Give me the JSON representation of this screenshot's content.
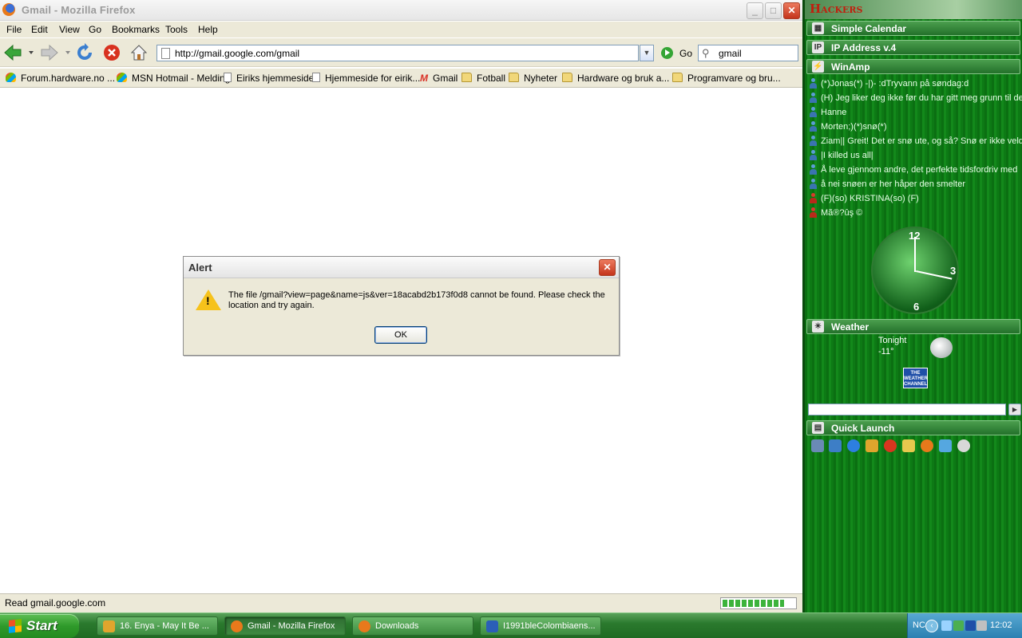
{
  "window": {
    "title": "Gmail - Mozilla Firefox"
  },
  "menu": [
    "File",
    "Edit",
    "View",
    "Go",
    "Bookmarks",
    "Tools",
    "Help"
  ],
  "navbar": {
    "url": "http://gmail.google.com/gmail",
    "go_label": "Go",
    "search_value": "gmail"
  },
  "bookmarks": [
    {
      "label": "Forum.hardware.no ...",
      "icon": "ms"
    },
    {
      "label": "MSN Hotmail - Melding",
      "icon": "ms"
    },
    {
      "label": "Eiriks hjemmeside",
      "icon": "page"
    },
    {
      "label": "Hjemmeside for eirik...",
      "icon": "page"
    },
    {
      "label": "Gmail",
      "icon": "gmail"
    },
    {
      "label": "Fotball",
      "icon": "folder"
    },
    {
      "label": "Nyheter",
      "icon": "folder"
    },
    {
      "label": "Hardware og bruk a...",
      "icon": "folder"
    },
    {
      "label": "Programvare og bru...",
      "icon": "folder"
    }
  ],
  "status": {
    "text": "Read gmail.google.com",
    "progress": 0.85
  },
  "alert": {
    "title": "Alert",
    "message": "The file /gmail?view=page&name=js&ver=18acabd2b173f0d8 cannot be found. Please check the location and try again.",
    "ok_label": "OK"
  },
  "sidebar": {
    "brand": "Hackers",
    "gadgets": {
      "calendar": "Simple Calendar",
      "ip": "IP Address v.4",
      "winamp": "WinAmp",
      "weather": "Weather",
      "quick_launch": "Quick Launch"
    },
    "winamp_items": [
      {
        "text": "(*)Jonas(*) -|)- :dTryvann på søndag:d",
        "status": "online"
      },
      {
        "text": "(H) Jeg liker deg ikke før du har gitt meg grunn til det",
        "status": "online"
      },
      {
        "text": "Hanne",
        "status": "online"
      },
      {
        "text": "Morten;)(*)snø(*)",
        "status": "online"
      },
      {
        "text": "Ziam|| Greit! Det er snø ute, og så? Snø er ikke veldig",
        "status": "online"
      },
      {
        "text": "|I killed us all|",
        "status": "online"
      },
      {
        "text": "Å leve gjennom andre, det perfekte tidsfordriv med",
        "status": "online"
      },
      {
        "text": "å nei snøen er her håper den smelter",
        "status": "online"
      },
      {
        "text": "(F)(so) KRISTINA(so) (F)",
        "status": "away"
      },
      {
        "text": "Mã®?ûş      ©",
        "status": "away"
      }
    ],
    "clock": {
      "n12": "12",
      "n3": "3",
      "n6": "6"
    },
    "weather": {
      "period": "Tonight",
      "temp": "-11°",
      "logo": "THE WEATHER CHANNEL"
    }
  },
  "taskbar": {
    "start": "Start",
    "buttons": [
      {
        "label": "16. Enya - May It Be ...",
        "active": false
      },
      {
        "label": "Gmail - Mozilla Firefox",
        "active": true
      },
      {
        "label": "Downloads",
        "active": false
      },
      {
        "label": "I1991bleColombiaens...",
        "active": false
      }
    ],
    "tray_lang": "NC",
    "time": "12:02"
  }
}
